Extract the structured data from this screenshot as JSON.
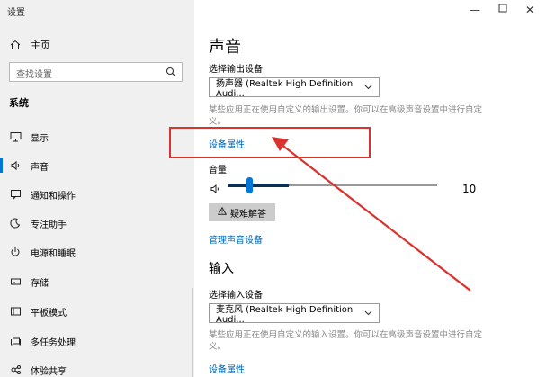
{
  "window": {
    "title": "设置"
  },
  "sidebar": {
    "home": "主页",
    "search_placeholder": "查找设置",
    "section": "系统",
    "items": [
      {
        "label": "显示",
        "icon": "display-icon"
      },
      {
        "label": "声音",
        "icon": "speaker-icon",
        "active": true
      },
      {
        "label": "通知和操作",
        "icon": "notification-icon"
      },
      {
        "label": "专注助手",
        "icon": "moon-icon"
      },
      {
        "label": "电源和睡眠",
        "icon": "power-icon"
      },
      {
        "label": "存储",
        "icon": "storage-icon"
      },
      {
        "label": "平板模式",
        "icon": "tablet-icon"
      },
      {
        "label": "多任务处理",
        "icon": "multitask-icon"
      },
      {
        "label": "体验共享",
        "icon": "share-icon"
      }
    ]
  },
  "main": {
    "title": "声音",
    "output": {
      "label": "选择输出设备",
      "device": "扬声器 (Realtek High Definition Audi...",
      "hint": "某些应用正在使用自定义的输出设置。你可以在高级声音设置中进行自定义。",
      "properties_link": "设备属性"
    },
    "volume": {
      "label": "音量",
      "value": "10",
      "level_percent": 10
    },
    "troubleshoot": "疑难解答",
    "manage_link": "管理声音设备",
    "input": {
      "title": "输入",
      "label": "选择输入设备",
      "device": "麦克风 (Realtek High Definition Audi...",
      "hint": "某些应用正在使用自定义的输入设置。你可以在高级声音设置中进行自定义。",
      "properties_link": "设备属性"
    }
  },
  "colors": {
    "accent": "#0078d7",
    "link": "#0063b1",
    "annotation": "#d9332f"
  }
}
